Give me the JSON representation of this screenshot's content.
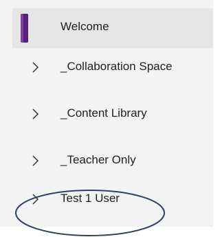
{
  "sections": [
    {
      "label": "Welcome",
      "selected": true
    },
    {
      "label": "_Collaboration Space",
      "selected": false
    },
    {
      "label": "_Content Library",
      "selected": false
    },
    {
      "label": "_Teacher Only",
      "selected": false
    },
    {
      "label": "Test 1 User",
      "selected": false
    }
  ],
  "icons": {
    "selected_marker": "section-color-marker",
    "expand": "chevron-right-icon"
  },
  "colors": {
    "panel_background": "#f3f3f3",
    "selected_row": "#e6e6e6",
    "section_marker": "#7b3fa0",
    "annotation_circle": "#2f3f68"
  }
}
